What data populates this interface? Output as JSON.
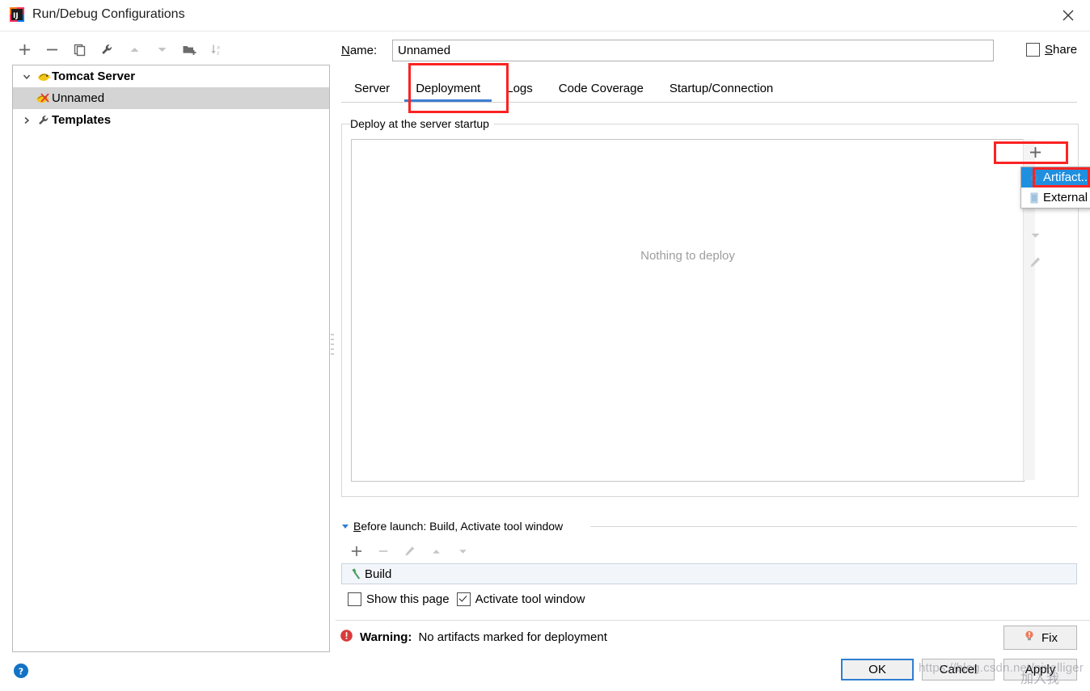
{
  "window": {
    "title": "Run/Debug Configurations",
    "app_icon": "intellij-idea-icon",
    "close_label": "✕"
  },
  "left_toolbar": {
    "buttons": [
      {
        "name": "add-configuration-button",
        "icon": "plus-icon"
      },
      {
        "name": "remove-configuration-button",
        "icon": "minus-icon"
      },
      {
        "name": "copy-configuration-button",
        "icon": "copy-icon"
      },
      {
        "name": "edit-templates-button",
        "icon": "wrench-icon"
      },
      {
        "name": "move-up-button",
        "icon": "arrow-up-icon"
      },
      {
        "name": "move-down-button",
        "icon": "arrow-down-icon"
      },
      {
        "name": "new-folder-button",
        "icon": "folder-add-icon"
      },
      {
        "name": "sort-alphabetically-button",
        "icon": "sort-az-icon"
      }
    ]
  },
  "tree": {
    "items": [
      {
        "label": "Tomcat Server",
        "icon": "tomcat-icon",
        "twisty": "chevron-down-icon",
        "bold": true,
        "indent": 0,
        "selected": false
      },
      {
        "label": "Unnamed",
        "icon": "tomcat-error-icon",
        "twisty": "",
        "bold": false,
        "indent": 1,
        "selected": true
      },
      {
        "label": "Templates",
        "icon": "wrench-icon",
        "twisty": "chevron-right-icon",
        "bold": true,
        "indent": 0,
        "selected": false
      }
    ]
  },
  "name_field": {
    "label_prefix": "",
    "label_mnemonic": "N",
    "label_suffix": "ame:",
    "value": "Unnamed",
    "placeholder": "Unnamed"
  },
  "share": {
    "label_mnemonic": "S",
    "label_suffix": "hare",
    "checked": false
  },
  "tabs": [
    {
      "label": "Server",
      "active": false
    },
    {
      "label": "Deployment",
      "active": true
    },
    {
      "label": "Logs",
      "active": false
    },
    {
      "label": "Code Coverage",
      "active": false
    },
    {
      "label": "Startup/Connection",
      "active": false
    }
  ],
  "deployment": {
    "group_legend": "Deploy at the server startup",
    "empty_message": "Nothing to deploy",
    "toolbar": [
      {
        "name": "add-deployment-button",
        "icon": "plus-icon",
        "enabled": true
      },
      {
        "name": "remove-deployment-button",
        "icon": "minus-icon",
        "enabled": false
      },
      {
        "name": "move-deployment-up-button",
        "icon": "arrow-up-icon",
        "enabled": false
      },
      {
        "name": "move-deployment-down-button",
        "icon": "arrow-down-icon",
        "enabled": false
      },
      {
        "name": "edit-deployment-button",
        "icon": "pencil-icon",
        "enabled": false
      }
    ],
    "popup_menu": [
      {
        "label": "Artifact...",
        "icon": "artifact-icon",
        "selected": true
      },
      {
        "label": "External Source...",
        "icon": "external-source-icon",
        "selected": false
      }
    ]
  },
  "before_launch": {
    "twisty": "triangle-down-icon",
    "header_mnemonic": "B",
    "header_suffix": "efore launch: Build, Activate tool window",
    "toolbar": [
      {
        "name": "add-before-launch-task-button",
        "icon": "plus-icon",
        "enabled": true
      },
      {
        "name": "remove-before-launch-task-button",
        "icon": "minus-icon",
        "enabled": false
      },
      {
        "name": "edit-before-launch-task-button",
        "icon": "pencil-icon",
        "enabled": false
      },
      {
        "name": "move-task-up-button",
        "icon": "arrow-up-icon",
        "enabled": false
      },
      {
        "name": "move-task-down-button",
        "icon": "arrow-down-icon",
        "enabled": false
      }
    ],
    "tasks": [
      {
        "label": "Build",
        "icon": "build-hammer-icon"
      }
    ],
    "checkboxes": [
      {
        "label": "Show this page",
        "checked": false
      },
      {
        "label": "Activate tool window",
        "checked": true
      }
    ]
  },
  "status": {
    "icon": "error-icon",
    "prefix": "Warning:",
    "message": "No artifacts marked for deployment",
    "fix_label": "Fix",
    "fix_icon": "lightbulb-icon"
  },
  "buttons": {
    "ok": "OK",
    "cancel": "Cancel",
    "apply": "Apply",
    "help_icon": "help-icon"
  },
  "watermark": {
    "url": "https://blog.csdn.net/pixelliger",
    "text": "加入我"
  },
  "colors": {
    "accent": "#3d7fd4",
    "annotation": "#fb2323",
    "selection": "#1f8fe0",
    "tree_selection": "#d4d4d4",
    "warning": "#d83b3b",
    "ok_border": "#2f7fd0"
  }
}
